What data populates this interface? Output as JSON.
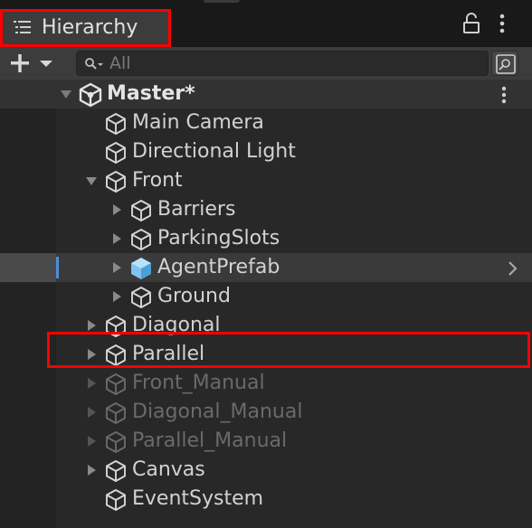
{
  "panel": {
    "title": "Hierarchy"
  },
  "toolbar": {
    "search_placeholder": "All"
  },
  "tree": {
    "rows": [
      {
        "label": "Master*",
        "depth": 0,
        "arrow": "expanded",
        "icon": "unity-scene-icon",
        "state": "scene"
      },
      {
        "label": "Main Camera",
        "depth": 1,
        "arrow": "none",
        "icon": "gameobject-cube-icon",
        "state": "normal"
      },
      {
        "label": "Directional Light",
        "depth": 1,
        "arrow": "none",
        "icon": "gameobject-cube-icon",
        "state": "normal"
      },
      {
        "label": "Front",
        "depth": 1,
        "arrow": "expanded",
        "icon": "gameobject-cube-icon",
        "state": "normal"
      },
      {
        "label": "Barriers",
        "depth": 2,
        "arrow": "collapsed",
        "icon": "gameobject-cube-icon",
        "state": "normal"
      },
      {
        "label": "ParkingSlots",
        "depth": 2,
        "arrow": "collapsed",
        "icon": "gameobject-cube-icon",
        "state": "normal"
      },
      {
        "label": "AgentPrefab",
        "depth": 2,
        "arrow": "collapsed",
        "icon": "prefab-cube-icon",
        "state": "selected"
      },
      {
        "label": "Ground",
        "depth": 2,
        "arrow": "collapsed",
        "icon": "gameobject-cube-icon",
        "state": "normal"
      },
      {
        "label": "Diagonal",
        "depth": 1,
        "arrow": "collapsed",
        "icon": "gameobject-cube-icon",
        "state": "normal"
      },
      {
        "label": "Parallel",
        "depth": 1,
        "arrow": "collapsed",
        "icon": "gameobject-cube-icon",
        "state": "normal"
      },
      {
        "label": "Front_Manual",
        "depth": 1,
        "arrow": "collapsed",
        "icon": "gameobject-cube-icon",
        "state": "disabled"
      },
      {
        "label": "Diagonal_Manual",
        "depth": 1,
        "arrow": "collapsed",
        "icon": "gameobject-cube-icon",
        "state": "disabled"
      },
      {
        "label": "Parallel_Manual",
        "depth": 1,
        "arrow": "collapsed",
        "icon": "gameobject-cube-icon",
        "state": "disabled"
      },
      {
        "label": "Canvas",
        "depth": 1,
        "arrow": "collapsed",
        "icon": "gameobject-cube-icon",
        "state": "normal"
      },
      {
        "label": "EventSystem",
        "depth": 1,
        "arrow": "none",
        "icon": "gameobject-cube-icon",
        "state": "normal"
      }
    ]
  },
  "colors": {
    "background": "#282828",
    "tab_bar": "#191919",
    "panel_header": "#3c3c3c",
    "text": "#d2d2d2",
    "disabled_text": "#6a6a6a",
    "selection_accent": "#4d8fd6",
    "prefab_blue": "#7fc4ee",
    "highlight_box": "#ff0000"
  }
}
